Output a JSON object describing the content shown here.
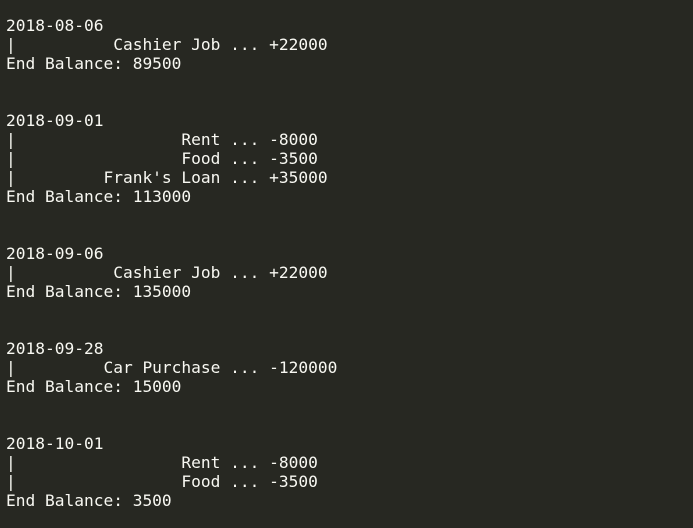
{
  "terminal": {
    "lines": [
      "2018-08-06",
      "|          Cashier Job ... +22000",
      "End Balance: 89500",
      "",
      "",
      "2018-09-01",
      "|                 Rent ... -8000",
      "|                 Food ... -3500",
      "|         Frank's Loan ... +35000",
      "End Balance: 113000",
      "",
      "",
      "2018-09-06",
      "|          Cashier Job ... +22000",
      "End Balance: 135000",
      "",
      "",
      "2018-09-28",
      "|         Car Purchase ... -120000",
      "End Balance: 15000",
      "",
      "",
      "2018-10-01",
      "|                 Rent ... -8000",
      "|                 Food ... -3500",
      "End Balance: 3500"
    ]
  }
}
